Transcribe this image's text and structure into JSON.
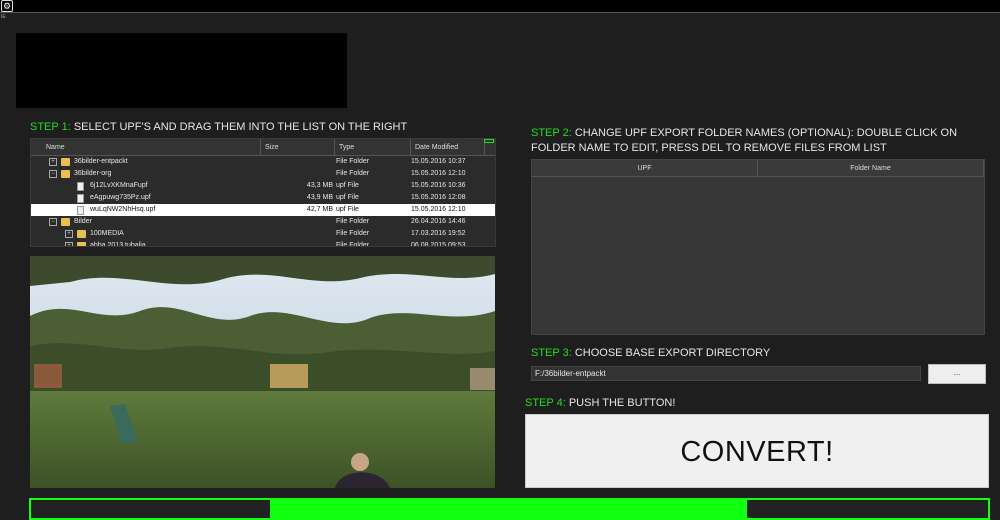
{
  "header": {
    "tiny_label": "IE"
  },
  "step1": {
    "num": "STEP 1:",
    "text": " SELECT UPF'S AND DRAG THEM INTO THE LIST ON THE RIGHT"
  },
  "explorer": {
    "columns": [
      "Name",
      "Size",
      "Type",
      "Date Modified"
    ],
    "rows": [
      {
        "name": "36bilder-entpackt",
        "size": "",
        "type": "File Folder",
        "date": "15.05.2016 10:37",
        "kind": "folder",
        "expander": "+",
        "level": 1
      },
      {
        "name": "36bilder-org",
        "size": "",
        "type": "File Folder",
        "date": "15.05.2016 12:10",
        "kind": "folder",
        "expander": "−",
        "level": 1
      },
      {
        "name": "6j12LvXKMnaFupf",
        "size": "43,3 MB",
        "type": "upf File",
        "date": "15.05.2016 10:36",
        "kind": "file",
        "expander": "",
        "level": 2
      },
      {
        "name": "eAgpuwg735Pz.upf",
        "size": "43,9 MB",
        "type": "upf File",
        "date": "15.05.2016 12:08",
        "kind": "file",
        "expander": "",
        "level": 2
      },
      {
        "name": "wuLqNW2NhHsq.upf",
        "size": "42,7 MB",
        "type": "upf File",
        "date": "15.05.2016 12:10",
        "kind": "file",
        "expander": "",
        "level": 2,
        "selected": true
      },
      {
        "name": "Bilder",
        "size": "",
        "type": "File Folder",
        "date": "26.04.2016 14:46",
        "kind": "folder",
        "expander": "−",
        "level": 1
      },
      {
        "name": "100MEDIA",
        "size": "",
        "type": "File Folder",
        "date": "17.03.2016 19:52",
        "kind": "folder",
        "expander": "+",
        "level": 2
      },
      {
        "name": "abba 2013 tubalia",
        "size": "",
        "type": "File Folder",
        "date": "06.08.2015 09:53",
        "kind": "folder",
        "expander": "+",
        "level": 2
      }
    ]
  },
  "step2": {
    "num": "STEP 2:",
    "text": " CHANGE UPF EXPORT FOLDER NAMES (OPTIONAL): DOUBLE CLICK ON FOLDER NAME TO EDIT, PRESS DEL TO REMOVE FILES FROM LIST"
  },
  "upf_table": {
    "col_upf": "UPF",
    "col_folder": "Folder Name"
  },
  "step3": {
    "num": "STEP 3:",
    "text": " CHOOSE BASE EXPORT DIRECTORY"
  },
  "export": {
    "directory": "F:/36bilder-entpackt",
    "browse_label": "..."
  },
  "step4": {
    "num": "STEP 4:",
    "text": " PUSH THE BUTTON!"
  },
  "convert": {
    "label": "CONVERT!"
  },
  "progress": {
    "start_fraction": 0.25,
    "end_fraction": 0.748,
    "color": "#11ff11"
  },
  "colors": {
    "accent": "#22dd22",
    "background": "#1e1e1e"
  }
}
